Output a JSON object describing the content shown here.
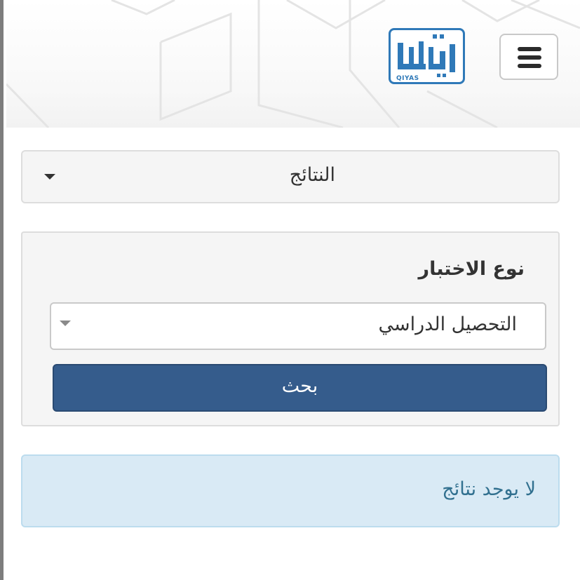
{
  "header": {
    "logo_text": "QIYAS",
    "menu_icon": "hamburger-icon"
  },
  "results_panel": {
    "title": "النتائج",
    "caret_icon": "caret-down-icon"
  },
  "search_form": {
    "test_type_label": "نوع الاختبار",
    "test_type_selected": "التحصيل الدراسي",
    "search_button_label": "بحث"
  },
  "alert": {
    "message": "لا يوجد نتائج"
  },
  "colors": {
    "brand_blue": "#2f79b8",
    "primary_button": "#355c8c",
    "alert_bg": "#d9eaf5",
    "alert_text": "#31708f"
  }
}
